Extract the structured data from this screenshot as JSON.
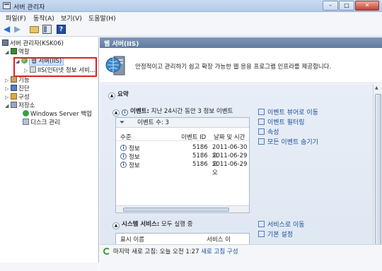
{
  "window": {
    "title": "서버 관리자",
    "buttons": {
      "minimize": "–",
      "maximize": "□",
      "close": "✕"
    }
  },
  "menu": [
    "파일(F)",
    "동작(A)",
    "보기(V)",
    "도움말(H)"
  ],
  "toolbar": {
    "back": "◀",
    "forward": "▶",
    "help": "?"
  },
  "tree": {
    "root": "서버 관리자(KSK06)",
    "roles": "역할",
    "web_server": "웹 서버(IIS)",
    "iis_manager": "IIS(인터넷 정보 서비...",
    "features": "기능",
    "diagnostics": "진단",
    "configuration": "구성",
    "storage": "저장소",
    "backup": "Windows Server 백업",
    "disk": "디스크 관리"
  },
  "pane": {
    "header": "웹 서버(IIS)",
    "description": "안정적이고 관리하기 쉽고 확장 가능한 웹 응용 프로그램 인프라를 제공합니다.",
    "summary_title": "요약",
    "events_title": "이벤트:",
    "events_subtitle": "지난 24시간 동안 3 정보 이벤트",
    "event_count": "이벤트 수: 3",
    "event_columns": [
      "수준",
      "이벤트 ID",
      "날짜 및 시간"
    ],
    "events": [
      {
        "level": "정보",
        "id": "5186",
        "date": "2011-06-30 오"
      },
      {
        "level": "정보",
        "id": "5186",
        "date": "2011-06-29 오"
      },
      {
        "level": "정보",
        "id": "5186",
        "date": "2011-06-29 오"
      }
    ],
    "event_actions": [
      "이벤트 뷰어로 이동",
      "이벤트 필터링",
      "속성",
      "모든 이벤트 숨기기"
    ],
    "services_title": "시스템 서비스:",
    "services_subtitle": "모두 실행 중",
    "service_columns": [
      "표시 이름",
      "서비스 이"
    ],
    "service_actions": [
      "서비스로 이동",
      "기본 설정"
    ]
  },
  "status": {
    "text": "마지막 새로 고침: 오늘 오전 1:27",
    "link": "새로 고침 구성"
  },
  "colors": {
    "highlight_box": "#e02020",
    "link": "#1a4f9a",
    "header": "#6f8aaf"
  }
}
